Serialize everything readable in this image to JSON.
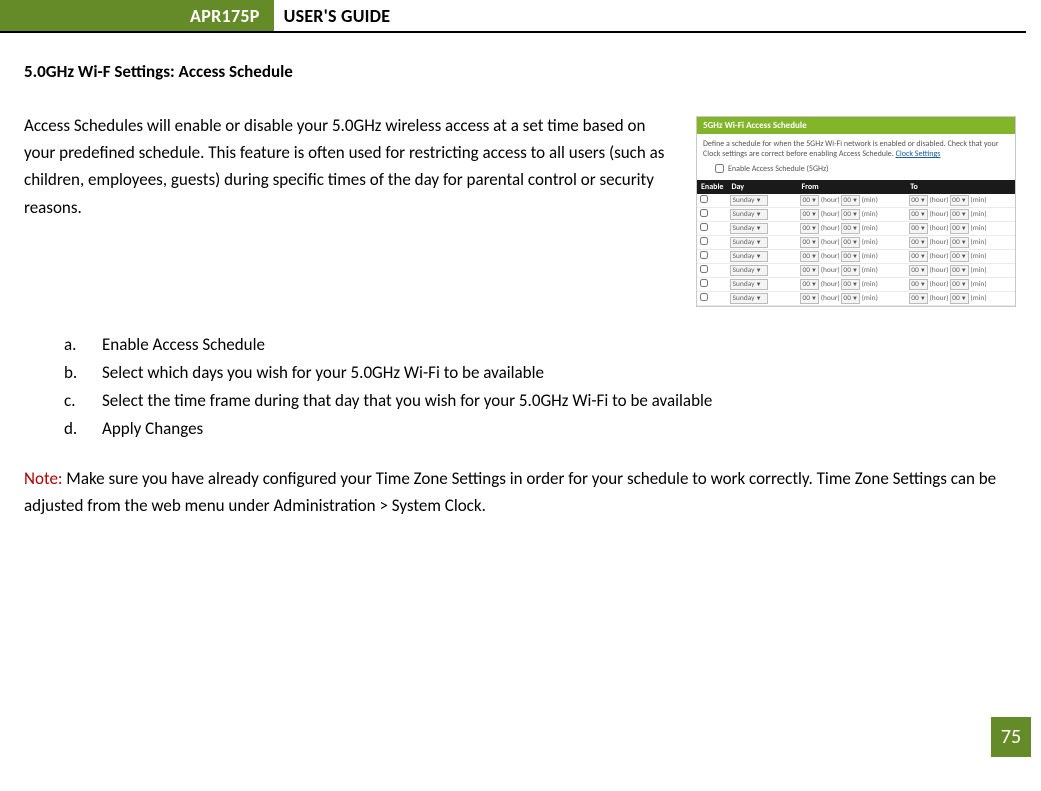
{
  "header": {
    "badge": "APR175P",
    "title": "USER'S GUIDE"
  },
  "section_heading": "5.0GHz Wi-F Settings: Access Schedule",
  "intro": "Access Schedules will enable or disable your 5.0GHz wireless access at a set time based on your predefined schedule.  This feature is often used for restricting access to all users (such as children, employees, guests) during specific times of the day for parental control or security reasons.",
  "steps": [
    {
      "marker": "a.",
      "text": "Enable Access Schedule"
    },
    {
      "marker": "b.",
      "text": "Select which days you wish for your 5.0GHz Wi-Fi to be available"
    },
    {
      "marker": "c.",
      "text": "Select the time frame during that day that you wish for your 5.0GHz Wi-Fi to be available"
    },
    {
      "marker": "d.",
      "text": "Apply Changes"
    }
  ],
  "note": {
    "label": "Note:",
    "text": " Make sure you have already configured your Time Zone Settings in order for your schedule to work correctly. Time Zone Settings can be adjusted from the web menu under Administration > System Clock."
  },
  "page_number": "75",
  "thumb": {
    "title": "5GHz Wi-Fi Access Schedule",
    "desc_prefix": "Define a schedule for when the 5GHz Wi-Fi network is enabled or disabled. Check that your Clock settings are correct before enabling Access Schedule. ",
    "desc_link": "Clock Settings",
    "enable_label": "Enable Access Schedule (5GHz)",
    "columns": {
      "enable": "Enable",
      "day": "Day",
      "from": "From",
      "to": "To"
    },
    "row": {
      "day": "Sunday",
      "hour": "00",
      "hour_label": "(hour)",
      "min": "00",
      "min_label": "(min)"
    },
    "row_count": 8
  }
}
